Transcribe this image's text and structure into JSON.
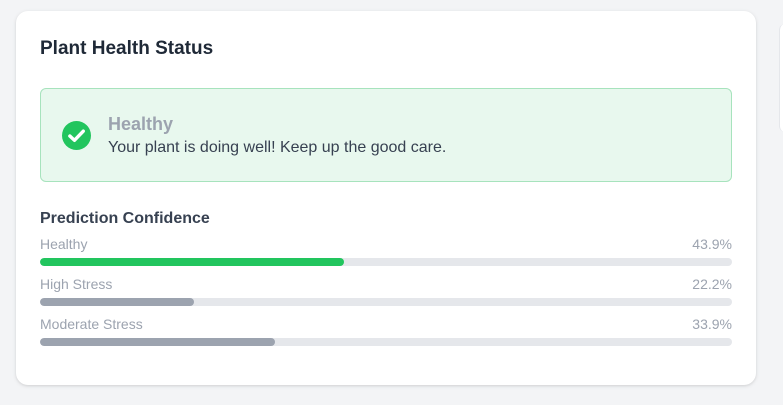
{
  "card": {
    "title": "Plant Health Status"
  },
  "status": {
    "label": "Healthy",
    "message": "Your plant is doing well! Keep up the good care.",
    "icon": "check-circle-icon",
    "color": "#22c55e"
  },
  "confidence": {
    "title": "Prediction Confidence",
    "items": [
      {
        "label": "Healthy",
        "percent_text": "43.9%",
        "value": 43.9,
        "color": "#22c55e"
      },
      {
        "label": "High Stress",
        "percent_text": "22.2%",
        "value": 22.2,
        "color": "#9ca3af"
      },
      {
        "label": "Moderate Stress",
        "percent_text": "33.9%",
        "value": 33.9,
        "color": "#9ca3af"
      }
    ]
  }
}
